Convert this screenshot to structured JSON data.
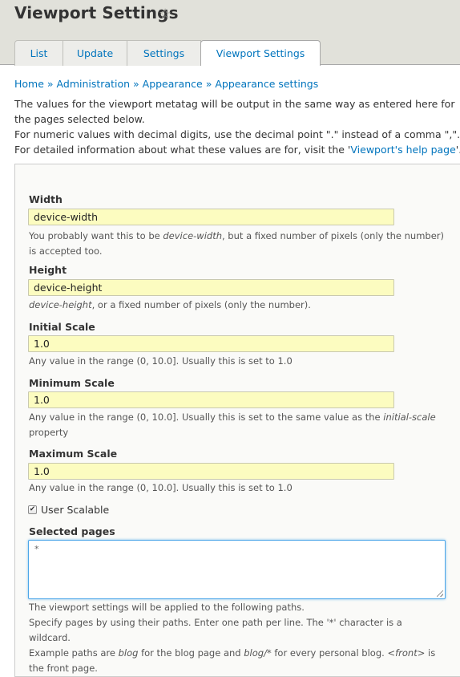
{
  "header": {
    "title": "Viewport Settings",
    "star_icon": "star-outline-icon",
    "tabs": [
      {
        "label": "List",
        "active": false
      },
      {
        "label": "Update",
        "active": false
      },
      {
        "label": "Settings",
        "active": false
      },
      {
        "label": "Viewport Settings",
        "active": true
      }
    ]
  },
  "breadcrumb": {
    "items": [
      "Home",
      "Administration",
      "Appearance",
      "Appearance settings"
    ],
    "separator": "»"
  },
  "intro": {
    "line1": "The values for the viewport metatag will be output in the same way as entered here for the pages selected below.",
    "line2": "For numeric values with decimal digits, use the decimal point \".\" instead of a comma \",\".",
    "line3_prefix": "For detailed information about what these values are for, visit the '",
    "line3_link": "Viewport's help page",
    "line3_suffix": "'."
  },
  "form": {
    "width": {
      "label": "Width",
      "value": "device-width",
      "desc_prefix": "You probably want this to be ",
      "desc_em": "device-width",
      "desc_suffix": ", but a fixed number of pixels (only the number) is accepted too."
    },
    "height": {
      "label": "Height",
      "value": "device-height",
      "desc_em": "device-height",
      "desc_suffix": ", or a fixed number of pixels (only the number)."
    },
    "initial_scale": {
      "label": "Initial Scale",
      "value": "1.0",
      "desc": "Any value in the range (0, 10.0]. Usually this is set to 1.0"
    },
    "minimum_scale": {
      "label": "Minimum Scale",
      "value": "1.0",
      "desc_prefix": "Any value in the range (0, 10.0]. Usually this is set to the same value as the ",
      "desc_em": "initial-scale",
      "desc_suffix": " property"
    },
    "maximum_scale": {
      "label": "Maximum Scale",
      "value": "1.0",
      "desc": "Any value in the range (0, 10.0]. Usually this is set to 1.0"
    },
    "user_scalable": {
      "label": "User Scalable",
      "checked": true
    },
    "selected_pages": {
      "label": "Selected pages",
      "value": "*",
      "desc_line1": "The viewport settings will be applied to the following paths.",
      "desc_line2": "Specify pages by using their paths. Enter one path per line. The '*' character is a wildcard.",
      "desc_line3_a": "Example paths are ",
      "desc_line3_em1": "blog",
      "desc_line3_b": " for the blog page and ",
      "desc_line3_em2": "blog/*",
      "desc_line3_c": " for every personal blog. ",
      "desc_line3_em3": "<front>",
      "desc_line3_d": " is the front page."
    }
  },
  "colors": {
    "link": "#0074bd",
    "header_bg": "#e1e1da",
    "input_bg": "#fcfcc0",
    "focus_border": "#4ca6e8"
  }
}
